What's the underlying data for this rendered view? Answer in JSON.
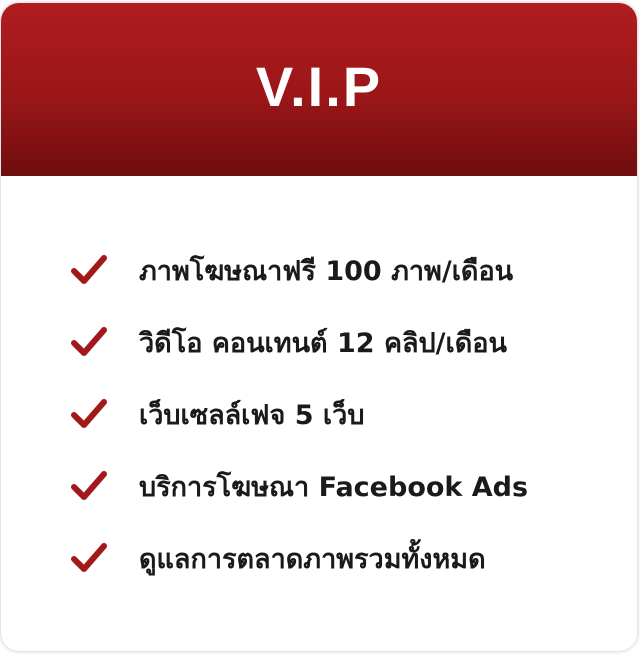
{
  "card": {
    "title": "V.I.P",
    "features": [
      {
        "label": "ภาพโฆษณาฟรี 100 ภาพ/เดือน",
        "icon": "check-icon"
      },
      {
        "label": "วิดีโอ คอนเทนต์ 12 คลิป/เดือน",
        "icon": "check-icon"
      },
      {
        "label": "เว็บเซลล์เฟจ 5 เว็บ",
        "icon": "check-icon"
      },
      {
        "label": "บริการโฆษณา Facebook Ads",
        "icon": "check-icon"
      },
      {
        "label": "ดูแลการตลาดภาพรวมทั้งหมด",
        "icon": "check-icon"
      }
    ]
  },
  "colors": {
    "header_top": "#b01c1f",
    "header_bottom": "#6e0d0f",
    "check": "#a3181b",
    "text": "#1a1a1a"
  }
}
